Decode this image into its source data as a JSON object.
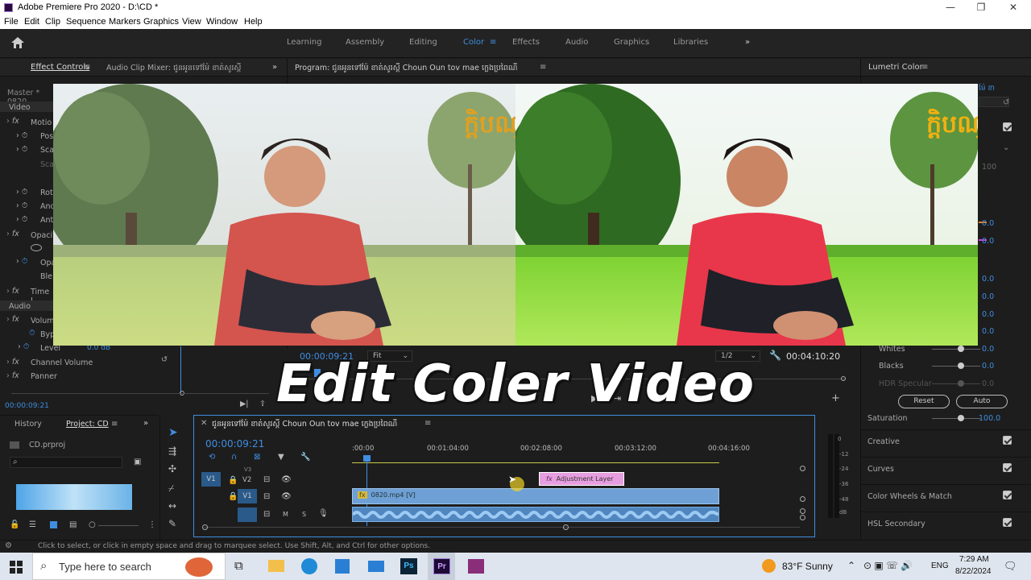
{
  "window": {
    "title": "Adobe Premiere Pro 2020 - D:\\CD *",
    "min": "—",
    "restore": "❐",
    "close": "✕"
  },
  "menu": [
    "File",
    "Edit",
    "Clip",
    "Sequence",
    "Markers",
    "Graphics",
    "View",
    "Window",
    "Help"
  ],
  "workspaces": {
    "items": [
      "Learning",
      "Assembly",
      "Editing",
      "Color",
      "Effects",
      "Audio",
      "Graphics",
      "Libraries"
    ],
    "active": "Color",
    "more": "»"
  },
  "effect_controls": {
    "tab": "Effect Controls",
    "mixer_tab": "Audio Clip Mixer: ជូនអូនទៅម៉ែ ខាត់សូរស្តី",
    "master": "Master * 0820",
    "video_label": "Video",
    "rows": [
      "Motio",
      "Pos",
      "Sca",
      "Sca",
      "Rot",
      "Anc",
      "Ant",
      "Opacit",
      "Opa",
      "Ble",
      "Time I"
    ],
    "audio_label": "Audio",
    "volume": "Volum",
    "bypass": "Byp",
    "level": "Level",
    "level_value": "0.0 dB",
    "channel_volume": "Channel Volume",
    "panner": "Panner",
    "time": "00:00:09:21"
  },
  "program": {
    "tab": "Program: ជូនអូនទៅម៉ែ ខាត់សូរស្តី  Choun Oun tov mae ក្លេងប្រពៃណី",
    "timecode": "00:00:09:21",
    "fit": "Fit",
    "resolution": "1/2",
    "duration": "00:04:10:20",
    "logo_text": "ក្ដិបណ្"
  },
  "lumetri": {
    "tab": "Lumetri Color",
    "value_100": "100",
    "values": [
      "0.0",
      "0.0",
      "0.0",
      "0.0",
      "0.0",
      "0.0",
      "0.0"
    ],
    "whites": "Whites",
    "whites_value": "0.0",
    "blacks": "Blacks",
    "blacks_value": "0.0",
    "hdr": "HDR Specular",
    "hdr_value": "0.0",
    "reset": "Reset",
    "auto": "Auto",
    "saturation": "Saturation",
    "saturation_value": "100.0",
    "sections": [
      "Creative",
      "Curves",
      "Color Wheels & Match",
      "HSL Secondary"
    ]
  },
  "project": {
    "history_tab": "History",
    "project_tab": "Project: CD",
    "file": "CD.prproj"
  },
  "timeline": {
    "tab": "ជូនអូនទៅម៉ែ ខាត់សូរស្តី  Choun Oun tov mae ក្លេងប្រពៃណី",
    "timecode": "00:00:09:21",
    "ruler": [
      ":00:00",
      "00:01:04:00",
      "00:02:08:00",
      "00:03:12:00",
      "00:04:16:00"
    ],
    "tracks": {
      "v3": "V3",
      "v2": "V2",
      "v1": "V1",
      "src_v1": "V1",
      "m": "M",
      "s": "S"
    },
    "adjustment": "Adjustment Layer",
    "clip": "0820.mp4 [V]",
    "meter": [
      "0",
      "-12",
      "-24",
      "-36",
      "-48",
      "dB"
    ]
  },
  "overlay": {
    "title": "Edit Coler Video"
  },
  "status": {
    "hint": "Click to select, or click in empty space and drag to marquee select. Use Shift, Alt, and Ctrl for other options."
  },
  "taskbar": {
    "search": "Type here to search",
    "weather": "83°F  Sunny",
    "lang": "ENG",
    "time": "7:29 AM",
    "date": "8/22/2024",
    "ps": "Ps",
    "pr": "Pr"
  }
}
